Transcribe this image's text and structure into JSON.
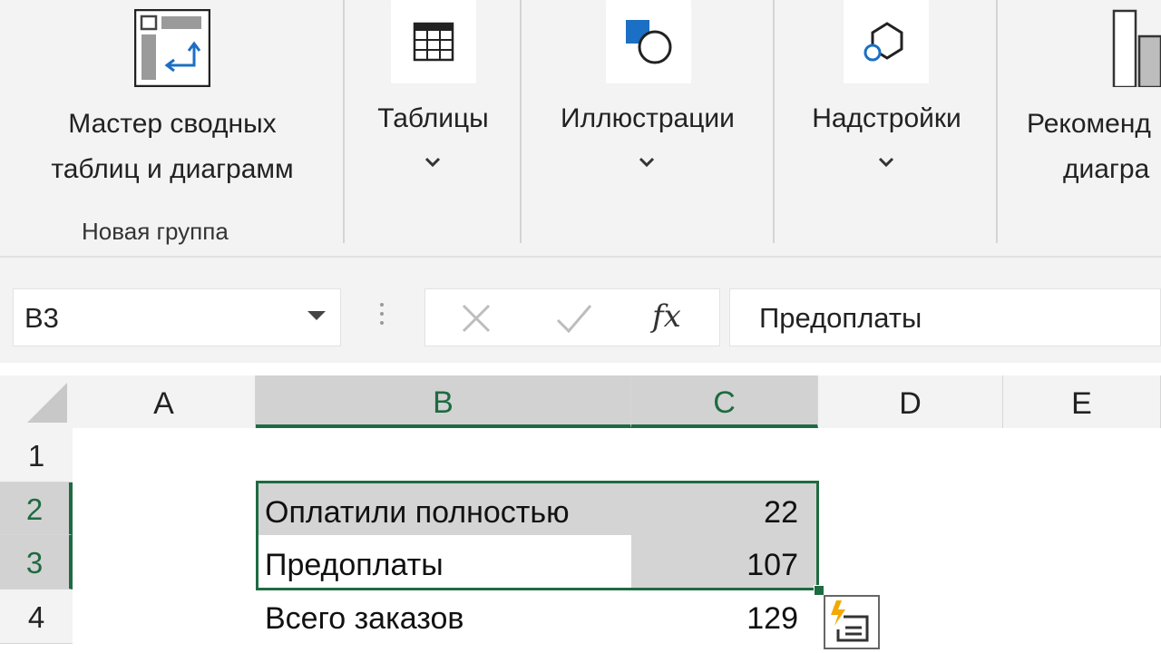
{
  "ribbon": {
    "pivot_wizard": {
      "label_line1": "Мастер сводных",
      "label_line2": "таблиц и диаграмм",
      "icon": "pivot-wizard-icon"
    },
    "new_group_label": "Новая группа",
    "tables": {
      "label": "Таблицы",
      "icon": "table-icon"
    },
    "illustrations": {
      "label": "Иллюстрации",
      "icon": "shapes-icon"
    },
    "addins": {
      "label": "Надстройки",
      "icon": "addins-icon"
    },
    "recommended_charts": {
      "label_line1": "Рекоменд",
      "label_line2": "диагра",
      "icon": "recommended-charts-icon"
    }
  },
  "formula_bar": {
    "name_box": "B3",
    "fx_label": "fx",
    "value": "Предоплаты"
  },
  "grid": {
    "columns": [
      "A",
      "B",
      "C",
      "D",
      "E"
    ],
    "selected_columns": [
      "B",
      "C"
    ],
    "rows": [
      "1",
      "2",
      "3",
      "4"
    ],
    "selected_rows": [
      "2",
      "3"
    ],
    "cells": {
      "B2": "Оплатили полностью",
      "C2": "22",
      "B3": "Предоплаты",
      "C3": "107",
      "B4": "Всего заказов",
      "C4": "129"
    }
  },
  "colors": {
    "accent": "#1e6b41",
    "selection": "#d4d4d4"
  }
}
